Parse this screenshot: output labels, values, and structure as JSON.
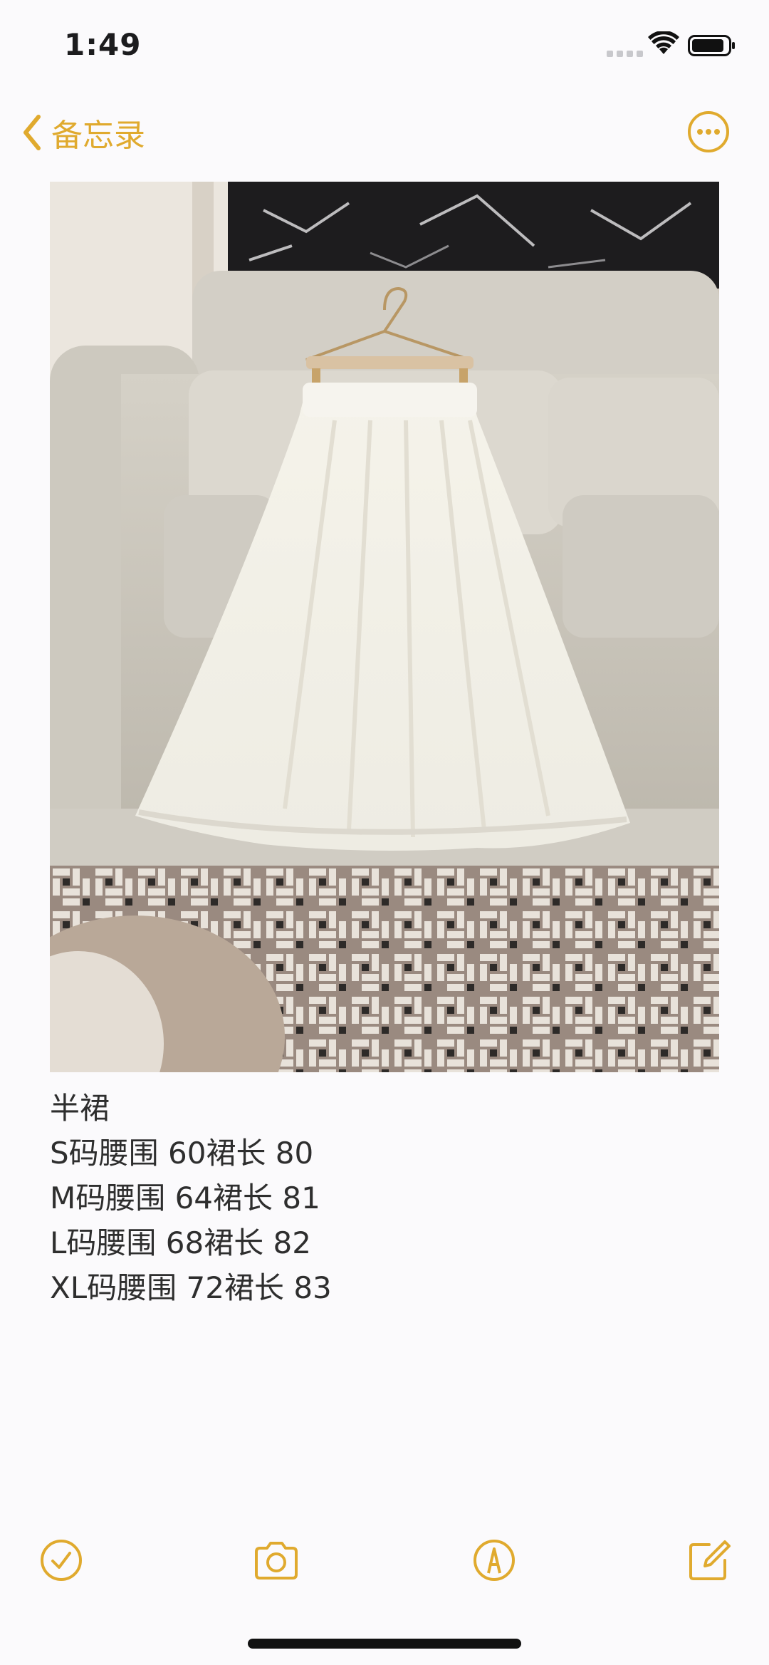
{
  "status_bar": {
    "time": "1:49"
  },
  "nav": {
    "back_label": "备忘录",
    "back_icon": "chevron-left-icon",
    "more_icon": "ellipsis-circle-icon"
  },
  "note": {
    "image_description_icon": "skirt-photo",
    "lines": [
      "半裙",
      "S码腰围 60裙长 80",
      "M码腰围 64裙长 81",
      "L码腰围 68裙长 82",
      "XL码腰围 72裙长 83"
    ]
  },
  "toolbar": {
    "items": [
      {
        "icon": "checklist-icon"
      },
      {
        "icon": "camera-icon"
      },
      {
        "icon": "markup-pen-icon"
      },
      {
        "icon": "compose-icon"
      }
    ]
  },
  "colors": {
    "accent": "#e0aa2e",
    "background": "#fbfafc",
    "text": "#2e2e2e"
  }
}
